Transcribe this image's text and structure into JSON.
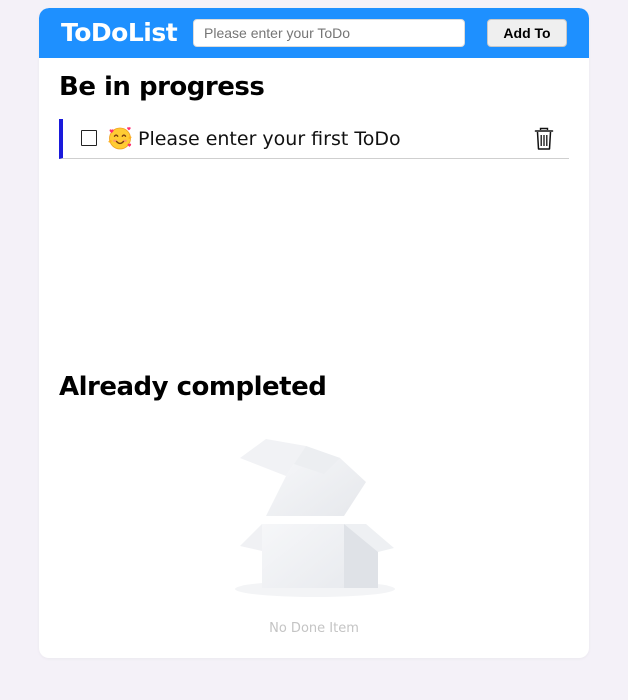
{
  "header": {
    "title": "ToDoList",
    "input_value": "",
    "input_placeholder": "Please enter your ToDo",
    "add_button_label": "Add To",
    "background_color": "#1e90ff"
  },
  "in_progress": {
    "title": "Be in progress",
    "items": [
      {
        "text": "Please enter your first ToDo",
        "checked": false,
        "emoji": "smiling-face-with-hearts-icon",
        "accent_color": "#1a1adb"
      }
    ]
  },
  "completed": {
    "title": "Already completed",
    "items": [],
    "empty_text": "No Done Item"
  }
}
